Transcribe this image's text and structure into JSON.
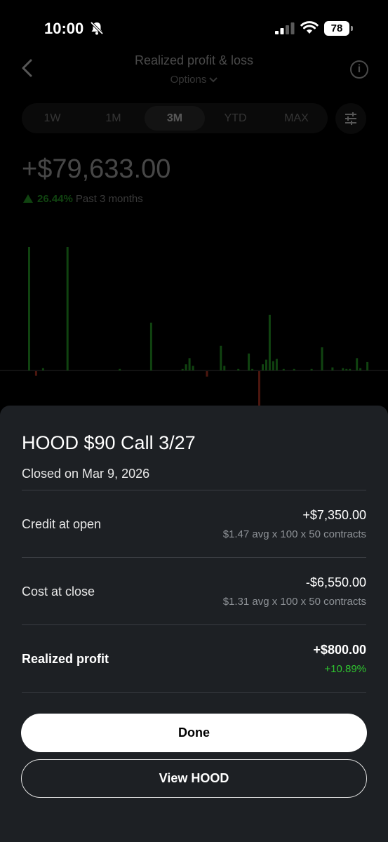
{
  "status_bar": {
    "time": "10:00",
    "battery": "78"
  },
  "header": {
    "title": "Realized profit & loss",
    "subtitle": "Options",
    "back_icon": "chevron-left-icon",
    "info_icon": "info-icon"
  },
  "range_tabs": [
    {
      "label": "1W",
      "active": false
    },
    {
      "label": "1M",
      "active": false
    },
    {
      "label": "3M",
      "active": true
    },
    {
      "label": "YTD",
      "active": false
    },
    {
      "label": "MAX",
      "active": false
    }
  ],
  "summary": {
    "total": "+$79,633.00",
    "change_pct": "26.44%",
    "period": "Past 3 months"
  },
  "colors": {
    "positive": "#2fc52f",
    "negative": "#e0452c",
    "sheet_bg": "#1d2024"
  },
  "chart_data": {
    "type": "bar",
    "values": [
      160,
      0,
      -6,
      0,
      3,
      0,
      0,
      0,
      0,
      0,
      0,
      160,
      0,
      0,
      0,
      0,
      0,
      0,
      0,
      0,
      0,
      0,
      0,
      0,
      0,
      0,
      2,
      0,
      0,
      0,
      0,
      0,
      0,
      0,
      0,
      62,
      0,
      0,
      0,
      0,
      0,
      0,
      0,
      0,
      2,
      8,
      16,
      6,
      0,
      0,
      0,
      -7,
      0,
      0,
      0,
      32,
      6,
      0,
      0,
      0,
      2,
      0,
      0,
      22,
      2,
      0,
      -45,
      8,
      14,
      72,
      12,
      15,
      0,
      2,
      0,
      0,
      2,
      0,
      0,
      0,
      0,
      2,
      0,
      0,
      30,
      0,
      0,
      4,
      0,
      0,
      3,
      2,
      2,
      0,
      16,
      3,
      0,
      11
    ]
  },
  "sheet": {
    "title": "HOOD $90 Call 3/27",
    "closed_on": "Closed on Mar 9, 2026",
    "rows": [
      {
        "label": "Credit at open",
        "value": "+$7,350.00",
        "sub": "$1.47 avg x 100 x 50 contracts"
      },
      {
        "label": "Cost at close",
        "value": "-$6,550.00",
        "sub": "$1.31 avg x 100 x 50 contracts"
      },
      {
        "label": "Realized profit",
        "value": "+$800.00",
        "sub": "+10.89%"
      }
    ],
    "done_label": "Done",
    "view_label": "View HOOD"
  }
}
